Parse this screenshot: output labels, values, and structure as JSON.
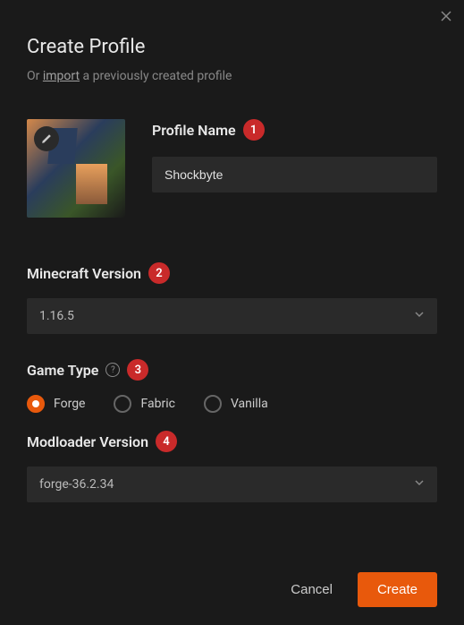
{
  "title": "Create Profile",
  "subtitle_prefix": "Or ",
  "import_link": "import",
  "subtitle_suffix": " a previously created profile",
  "profile_name": {
    "label": "Profile Name",
    "badge": "1",
    "value": "Shockbyte"
  },
  "minecraft_version": {
    "label": "Minecraft Version",
    "badge": "2",
    "value": "1.16.5"
  },
  "game_type": {
    "label": "Game Type",
    "badge": "3",
    "options": [
      {
        "label": "Forge",
        "selected": true
      },
      {
        "label": "Fabric",
        "selected": false
      },
      {
        "label": "Vanilla",
        "selected": false
      }
    ]
  },
  "modloader_version": {
    "label": "Modloader Version",
    "badge": "4",
    "value": "forge-36.2.34"
  },
  "buttons": {
    "cancel": "Cancel",
    "create": "Create"
  }
}
